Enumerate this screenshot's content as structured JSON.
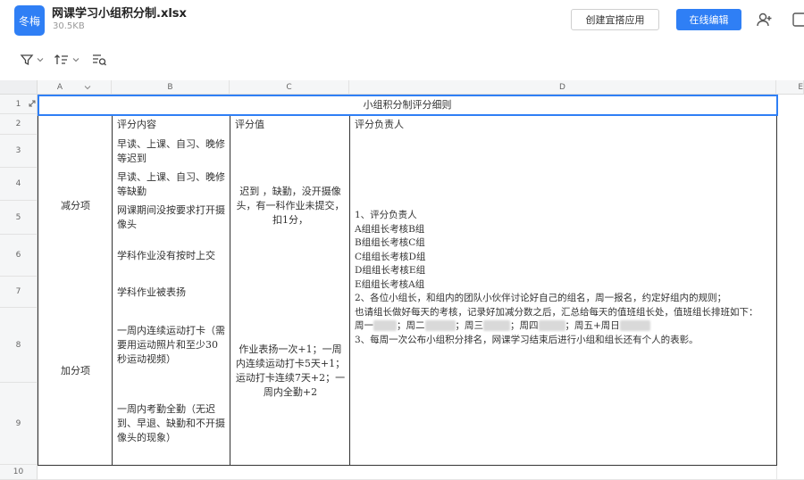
{
  "header": {
    "avatar": "冬梅",
    "file_title": "网课学习小组积分制.xlsx",
    "file_size": "30.5KB",
    "create_app_label": "创建宜搭应用",
    "edit_online_label": "在线编辑"
  },
  "toolbar": {
    "filter_icon": "filter-icon",
    "sort_icon": "sort-icon",
    "find_icon": "find-icon"
  },
  "sheet": {
    "columns": [
      "A",
      "B",
      "C",
      "D",
      "E"
    ],
    "rows": [
      "1",
      "2",
      "3",
      "4",
      "5",
      "6",
      "7",
      "8",
      "9",
      "10"
    ],
    "title": "小组积分制评分细则",
    "headers": {
      "b": "评分内容",
      "c": "评分值",
      "d": "评分负责人"
    },
    "deduct": {
      "label": "减分项",
      "items": [
        "早读、上课、自习、晚修等迟到",
        "早读、上课、自习、晚修等缺勤",
        "网课期间没按要求打开摄像头",
        "学科作业没有按时上交"
      ],
      "value": "迟到 ，缺勤，没开摄像头，有一科作业未提交，扣1分，"
    },
    "add": {
      "label": "加分项",
      "items": [
        "学科作业被表扬",
        "一周内连续运动打卡（需要用运动照片和至少30秒运动视频）",
        "一周内考勤全勤（无迟到、早退、缺勤和不开摄像头的现象）"
      ],
      "value": "作业表扬一次+1；一周内连续运动打卡5天+1；运动打卡连续7天+2；一周内全勤+2"
    },
    "responsible": {
      "lines": [
        "1、评分负责人",
        "A组组长考核B组",
        "B组组长考核C组",
        "C组组长考核D组",
        "D组组长考核E组",
        "E组组长考核A组"
      ],
      "para2": "2、各位小组长，和组内的团队小伙伴讨论好自己的组名，周一报名，约定好组内的规则；",
      "para3": "也请组长做好每天的考核，记录好加减分数之后，汇总给每天的值班组长处，值班组长排班如下：",
      "schedule": [
        "周一",
        "；周二",
        "；周三",
        "；周四",
        "；周五+周日"
      ],
      "para4": "3、每周一次公布小组积分排名，网课学习结束后进行小组和组长还有个人的表彰。"
    }
  }
}
